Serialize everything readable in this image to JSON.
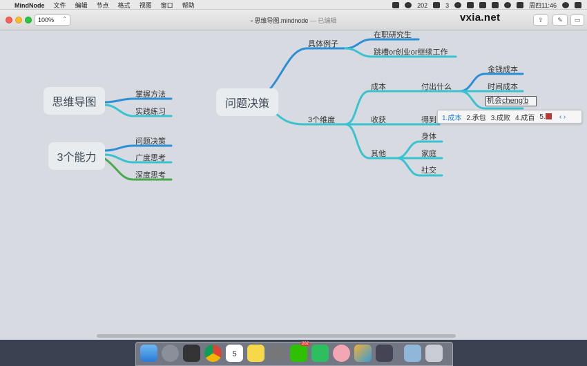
{
  "menubar": {
    "app_name": "MindNode",
    "menus": [
      "文件",
      "编辑",
      "节点",
      "格式",
      "视图",
      "窗口",
      "帮助"
    ],
    "tray_text_1": "202",
    "tray_text_2": "3",
    "clock": "周四11:46"
  },
  "window": {
    "zoom": "100%",
    "title": "思维导图.mindnode",
    "edited": "— 已编辑"
  },
  "watermark": "vxia.net",
  "mindmap": {
    "root1": "思维导图",
    "root1_children": [
      "掌握方法",
      "实践练习"
    ],
    "root2": "3个能力",
    "root2_children": [
      "问题决策",
      "广度思考",
      "深度思考"
    ],
    "root3": "问题决策",
    "example": "具体例子",
    "example_children": [
      "在职研究生",
      "跳槽or创业or继续工作"
    ],
    "dimensions": "3个维度",
    "cost": "成本",
    "pay": "付出什么",
    "pay_children": [
      "金钱成本",
      "时间成本"
    ],
    "editing_prefix": "机会",
    "editing_pinyin": "cheng'b",
    "gain": "收获",
    "gain_child": "得到",
    "other": "其他",
    "other_children": [
      "身体",
      "家庭",
      "社交"
    ]
  },
  "ime": {
    "candidates": [
      "1.成本",
      "2.承包",
      "3.成败",
      "4.成百",
      "5."
    ]
  },
  "colors": {
    "teal": "#39c2cf",
    "blue": "#2b8fd6",
    "green": "#4aa84e"
  },
  "dock": {
    "calendar_day": "5",
    "wechat_badge": "202"
  }
}
